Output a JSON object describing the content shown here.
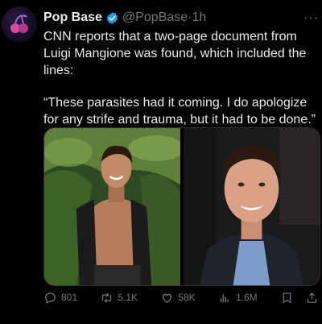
{
  "tweet": {
    "author_name": "Pop Base",
    "handle": "@PopBase",
    "separator": "·",
    "time": "1h",
    "paragraph1": "CNN reports that a two-page document from Luigi Mangione was found, which included the lines:",
    "paragraph2": "“These parasites had it coming. I do apologize for any strife and trauma, but it had to be done.”"
  },
  "actions": {
    "replies": "801",
    "reposts": "5.1K",
    "likes": "58K",
    "views": "1.6M"
  },
  "colors": {
    "background": "#000000",
    "text": "#e7e9ea",
    "muted": "#71767b",
    "verified": "#1d9bf0"
  },
  "icons": [
    "reply-icon",
    "repost-icon",
    "like-icon",
    "views-icon",
    "bookmark-icon",
    "share-icon",
    "verified-icon",
    "more-icon"
  ]
}
